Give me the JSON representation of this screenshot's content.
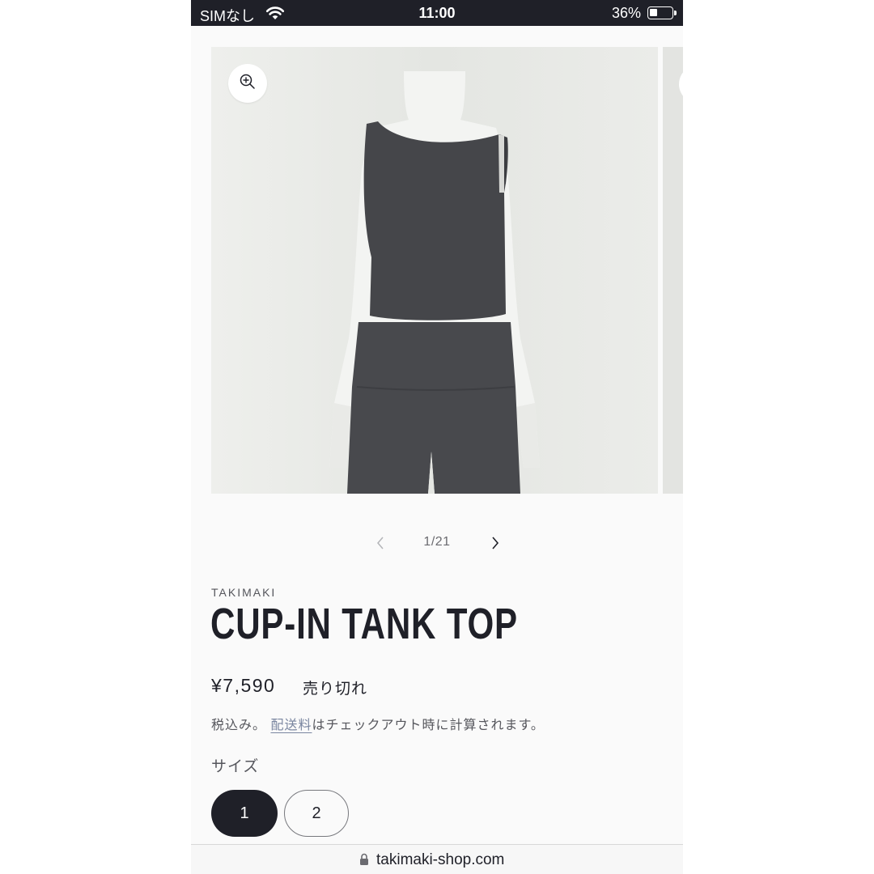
{
  "status_bar": {
    "carrier": "SIMなし",
    "time": "11:00",
    "battery_percent": "36%",
    "battery_level": 0.36,
    "wifi_icon": "wifi-icon",
    "battery_icon": "battery-icon"
  },
  "gallery": {
    "zoom_icon": "zoom-in-icon",
    "counter": "1/21"
  },
  "product": {
    "vendor": "TAKIMAKI",
    "title": "CUP-IN TANK TOP",
    "price": "¥7,590",
    "availability": "売り切れ",
    "tax_prefix": "税込み。",
    "shipping_link": "配送料",
    "tax_suffix": "はチェックアウト時に計算されます。"
  },
  "size_selector": {
    "label": "サイズ",
    "options": [
      "1",
      "2"
    ],
    "selected": "1"
  },
  "browser": {
    "url": "takimaki-shop.com",
    "lock_icon": "lock-icon"
  },
  "colors": {
    "dark": "#1f2028",
    "link": "#7a86a0",
    "page_bg": "#fafafa"
  }
}
